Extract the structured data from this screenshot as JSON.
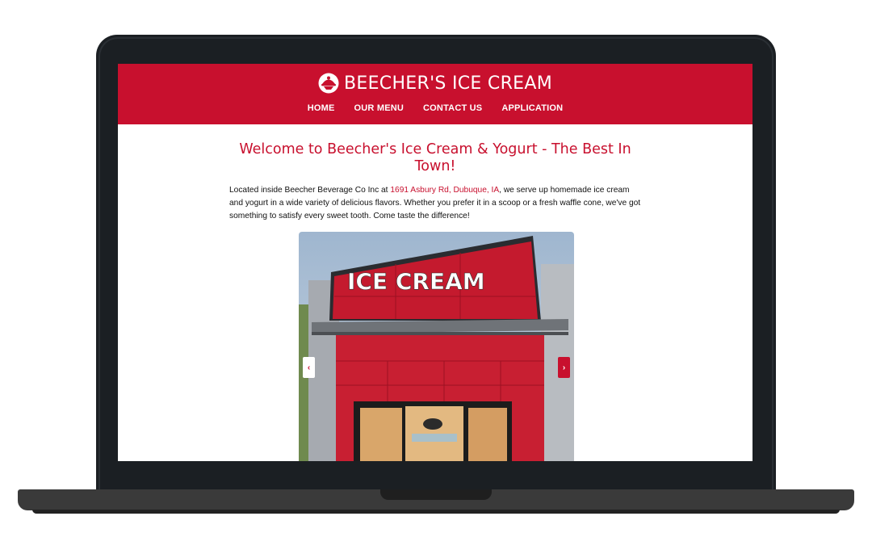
{
  "site": {
    "brand_name": "BEECHER'S ICE CREAM",
    "logo_icon": "ice-cream-dish-icon",
    "brand_color": "#c8102e"
  },
  "nav": {
    "items": [
      {
        "label": "HOME"
      },
      {
        "label": "OUR MENU"
      },
      {
        "label": "CONTACT US"
      },
      {
        "label": "APPLICATION"
      }
    ]
  },
  "main": {
    "welcome_title": "Welcome to Beecher's Ice Cream & Yogurt - The Best In Town!",
    "intro_before": "Located inside Beecher Beverage Co Inc at ",
    "address_link": "1691 Asbury Rd, Dubuque, IA",
    "intro_after": ", we serve up homemade ice cream and yogurt in a wide variety of delicious flavors. Whether you prefer it in a scoop or a fresh waffle cone, we've got something to satisfy every sweet tooth. Come taste the difference!"
  },
  "carousel": {
    "prev_label": "‹",
    "next_label": "›",
    "sign_text": "ICE CREAM"
  }
}
